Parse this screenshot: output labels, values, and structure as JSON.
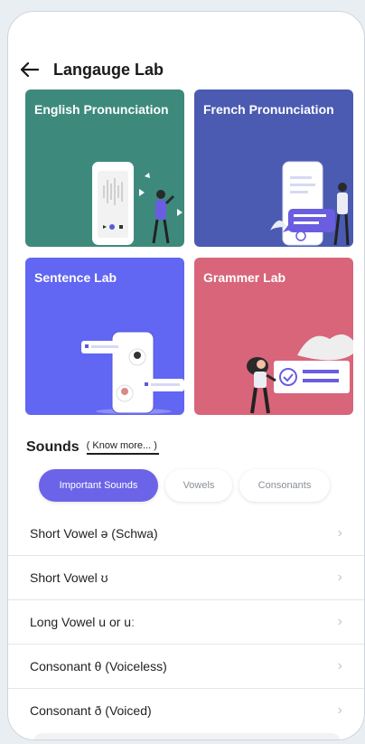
{
  "header": {
    "title": "Langauge Lab"
  },
  "cards": [
    {
      "label": "English Pronunciation",
      "color": "#3d8a7d"
    },
    {
      "label": "French Pronunciation",
      "color": "#4b5bb2"
    },
    {
      "label": "Sentence Lab",
      "color": "#6166f3"
    },
    {
      "label": "Grammer Lab",
      "color": "#d8657a"
    }
  ],
  "sounds": {
    "title": "Sounds",
    "know_more": "( Know more... )"
  },
  "tabs": [
    {
      "label": "Important Sounds",
      "active": true
    },
    {
      "label": "Vowels",
      "active": false
    },
    {
      "label": "Consonants",
      "active": false
    }
  ],
  "list": [
    {
      "label": "Short Vowel ə (Schwa)"
    },
    {
      "label": "Short Vowel ʊ"
    },
    {
      "label": "Long Vowel u or uː"
    },
    {
      "label": "Consonant θ (Voiceless)"
    },
    {
      "label": "Consonant ð (Voiced)"
    }
  ],
  "colors": {
    "accent": "#6b64e8"
  }
}
